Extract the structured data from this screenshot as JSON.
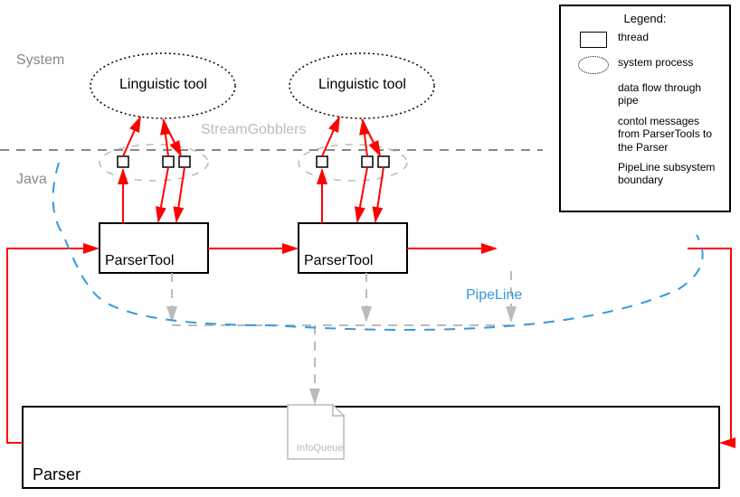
{
  "sections": {
    "system": "System",
    "java": "Java"
  },
  "nodes": {
    "linguistic_tool": "Linguistic tool",
    "parser_tool": "ParserTool",
    "parser": "Parser",
    "info_queue": "InfoQueue",
    "stream_gobblers": "StreamGobblers",
    "pipeline": "PipeLine"
  },
  "legend": {
    "title": "Legend:",
    "thread": "thread",
    "system_process": "system process",
    "data_flow": "data flow through pipe",
    "control_messages": "contol messages from ParserTools to the Parser",
    "pipeline_boundary": "PipeLine subsystem boundary"
  },
  "colors": {
    "red": "#ff0000",
    "gray": "#bbbbbb",
    "blue": "#3399dd",
    "section_gray": "#888888"
  }
}
